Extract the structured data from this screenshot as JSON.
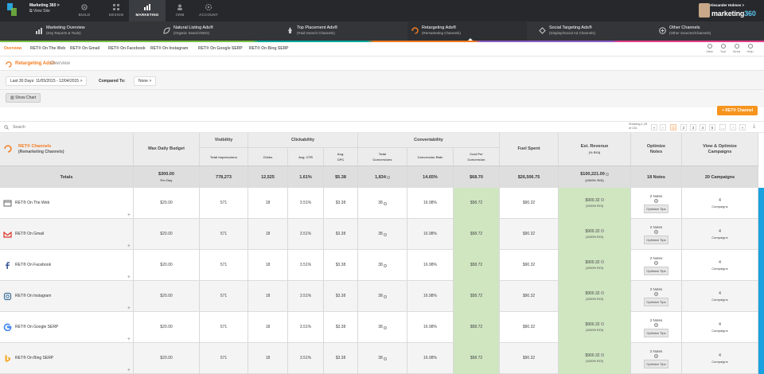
{
  "topbar": {
    "site_name": "Marketing 360 >",
    "view_site": "View Site",
    "nav": [
      {
        "label": "BUILD",
        "icon": "gear-icon"
      },
      {
        "label": "DESIGN",
        "icon": "grid-icon"
      },
      {
        "label": "MARKETING",
        "icon": "chart-icon"
      },
      {
        "label": "CRM",
        "icon": "people-icon"
      },
      {
        "label": "ACCOUNT",
        "icon": "settings-icon"
      }
    ],
    "user": "Alexander Holmes >",
    "brand_main": "marketing",
    "brand_num": "360"
  },
  "channels": [
    {
      "title": "Marketing Overview",
      "sub": "(Key Reports & Tools)"
    },
    {
      "title": "Natural Listing Ads®",
      "sub": "(Organic Search/SEO)"
    },
    {
      "title": "Top Placement Ads®",
      "sub": "(Paid Search Channels)"
    },
    {
      "title": "Retargeting Ads®",
      "sub": "(Remarketing Channels)"
    },
    {
      "title": "Social Targeting Ads®",
      "sub": "(Display/Social Ad Channels)"
    },
    {
      "title": "Other Channels",
      "sub": "(Other Sources/Channels)"
    }
  ],
  "subnav": [
    "Overview",
    "RET® On The Web",
    "RET® On Gmail",
    "RET® On Facebook",
    "RET® On Instagram",
    "RET® On Google SERP",
    "RET® On Bing SERP"
  ],
  "tools": [
    "View",
    "Tool",
    "Send",
    "Help"
  ],
  "page": {
    "title": "Retargeting Ads®",
    "sub": "Overview"
  },
  "filters": {
    "date": "Last 30 Days: 11/05/2015 - 12/04/2015 >",
    "compared_label": "Compared To:",
    "compared_value": "None >",
    "show_chart": "Show Chart",
    "add_button": "+ RET® Channel"
  },
  "search": {
    "placeholder": "Search",
    "showing": "Showing 1-25 of 131"
  },
  "pagination": [
    "«",
    "‹",
    "1",
    "2",
    "3",
    "4",
    "5",
    "...",
    "›",
    "»"
  ],
  "header": {
    "channels_title": "RET® Channels",
    "channels_sub": "(Remarketing Channels)",
    "max_budget": "Max Daily Budget",
    "visibility": "Visibility",
    "total_impressions": "Total Impressions",
    "clickability": "Clickability",
    "clicks": "Clicks",
    "avg_ctr": "Avg. CTR",
    "avg_cpc": "Avg. CPC",
    "convertability": "Convertability",
    "total_conversions": "Total Conversions",
    "conversion_rate": "Conversion Rate",
    "cost_per_conversion": "Cost Per Conversion",
    "fuel_spent": "Fuel Spent",
    "est_revenue": "Est. Revenue",
    "est_revenue_sub": "(% ROI)",
    "optimize_notes": "Optimize Notes",
    "view_optimize": "View & Optimize Campaigns"
  },
  "totals": {
    "label": "Totals",
    "budget": "$300.00",
    "budget_sub": "Per Day",
    "impressions": "778,273",
    "clicks": "12,525",
    "ctr": "1.61%",
    "cpc": "$5.38",
    "conversions": "1,834",
    "conv_rate": "14.65%",
    "cost_conv": "$68.70",
    "fuel": "$26,506.75",
    "revenue": "$100,221.00",
    "revenue_sub": "(1000% ROI)",
    "notes": "18 Notes",
    "campaigns": "20 Campaigns"
  },
  "rows": [
    {
      "name": "RET® On The Web",
      "icon": "web-icon",
      "budget": "$20.00",
      "impressions": "571",
      "clicks": "18",
      "ctr": "3.51%",
      "cpc": "$3.38",
      "conversions": "38",
      "conv_rate": "16.98%",
      "cost_conv": "$58.72",
      "fuel": "$90.32",
      "revenue": "$900.32",
      "revenue_sub": "(1000% ROI)",
      "notes": "2 Notes",
      "tips": "Optimize Tips",
      "campaigns": "4",
      "campaigns_sub": "Campaigns"
    },
    {
      "name": "RET® On Gmail",
      "icon": "gmail-icon",
      "budget": "$20.00",
      "impressions": "571",
      "clicks": "18",
      "ctr": "3.51%",
      "cpc": "$3.38",
      "conversions": "38",
      "conv_rate": "16.98%",
      "cost_conv": "$58.72",
      "fuel": "$90.32",
      "revenue": "$900.32",
      "revenue_sub": "(1000% ROI)",
      "notes": "2 Notes",
      "tips": "Optimize Tips",
      "campaigns": "4",
      "campaigns_sub": "Campaigns"
    },
    {
      "name": "RET® On Facebook",
      "icon": "facebook-icon",
      "budget": "$20.00",
      "impressions": "571",
      "clicks": "18",
      "ctr": "3.51%",
      "cpc": "$3.38",
      "conversions": "38",
      "conv_rate": "16.98%",
      "cost_conv": "$58.72",
      "fuel": "$90.32",
      "revenue": "$900.32",
      "revenue_sub": "(1000% ROI)",
      "notes": "2 Notes",
      "tips": "Optimize Tips",
      "campaigns": "4",
      "campaigns_sub": "Campaigns"
    },
    {
      "name": "RET® On Instagram",
      "icon": "instagram-icon",
      "budget": "$20.00",
      "impressions": "571",
      "clicks": "18",
      "ctr": "3.51%",
      "cpc": "$3.38",
      "conversions": "38",
      "conv_rate": "16.98%",
      "cost_conv": "$58.72",
      "fuel": "$90.32",
      "revenue": "$900.32",
      "revenue_sub": "(1000% ROI)",
      "notes": "2 Notes",
      "tips": "Optimize Tips",
      "campaigns": "4",
      "campaigns_sub": "Campaigns"
    },
    {
      "name": "RET® On Google SERP",
      "icon": "google-icon",
      "budget": "$20.00",
      "impressions": "571",
      "clicks": "18",
      "ctr": "3.51%",
      "cpc": "$3.38",
      "conversions": "38",
      "conv_rate": "16.98%",
      "cost_conv": "$58.72",
      "fuel": "$90.32",
      "revenue": "$900.32",
      "revenue_sub": "(1000% ROI)",
      "notes": "2 Notes",
      "tips": "Optimize Tips",
      "campaigns": "4",
      "campaigns_sub": "Campaigns"
    },
    {
      "name": "RET® On Bing SERP",
      "icon": "bing-icon",
      "budget": "$20.00",
      "impressions": "571",
      "clicks": "18",
      "ctr": "3.51%",
      "cpc": "$3.38",
      "conversions": "38",
      "conv_rate": "16.98%",
      "cost_conv": "$58.72",
      "fuel": "$90.32",
      "revenue": "$900.32",
      "revenue_sub": "(1000% ROI)",
      "notes": "2 Notes",
      "tips": "Optimize Tips",
      "campaigns": "4",
      "campaigns_sub": "Campaigns"
    }
  ],
  "colors": {
    "accent": "#f47b20",
    "topbar": "#26282b",
    "green_cell": "#cfe6c1",
    "scroll": "#1aa1e0"
  }
}
